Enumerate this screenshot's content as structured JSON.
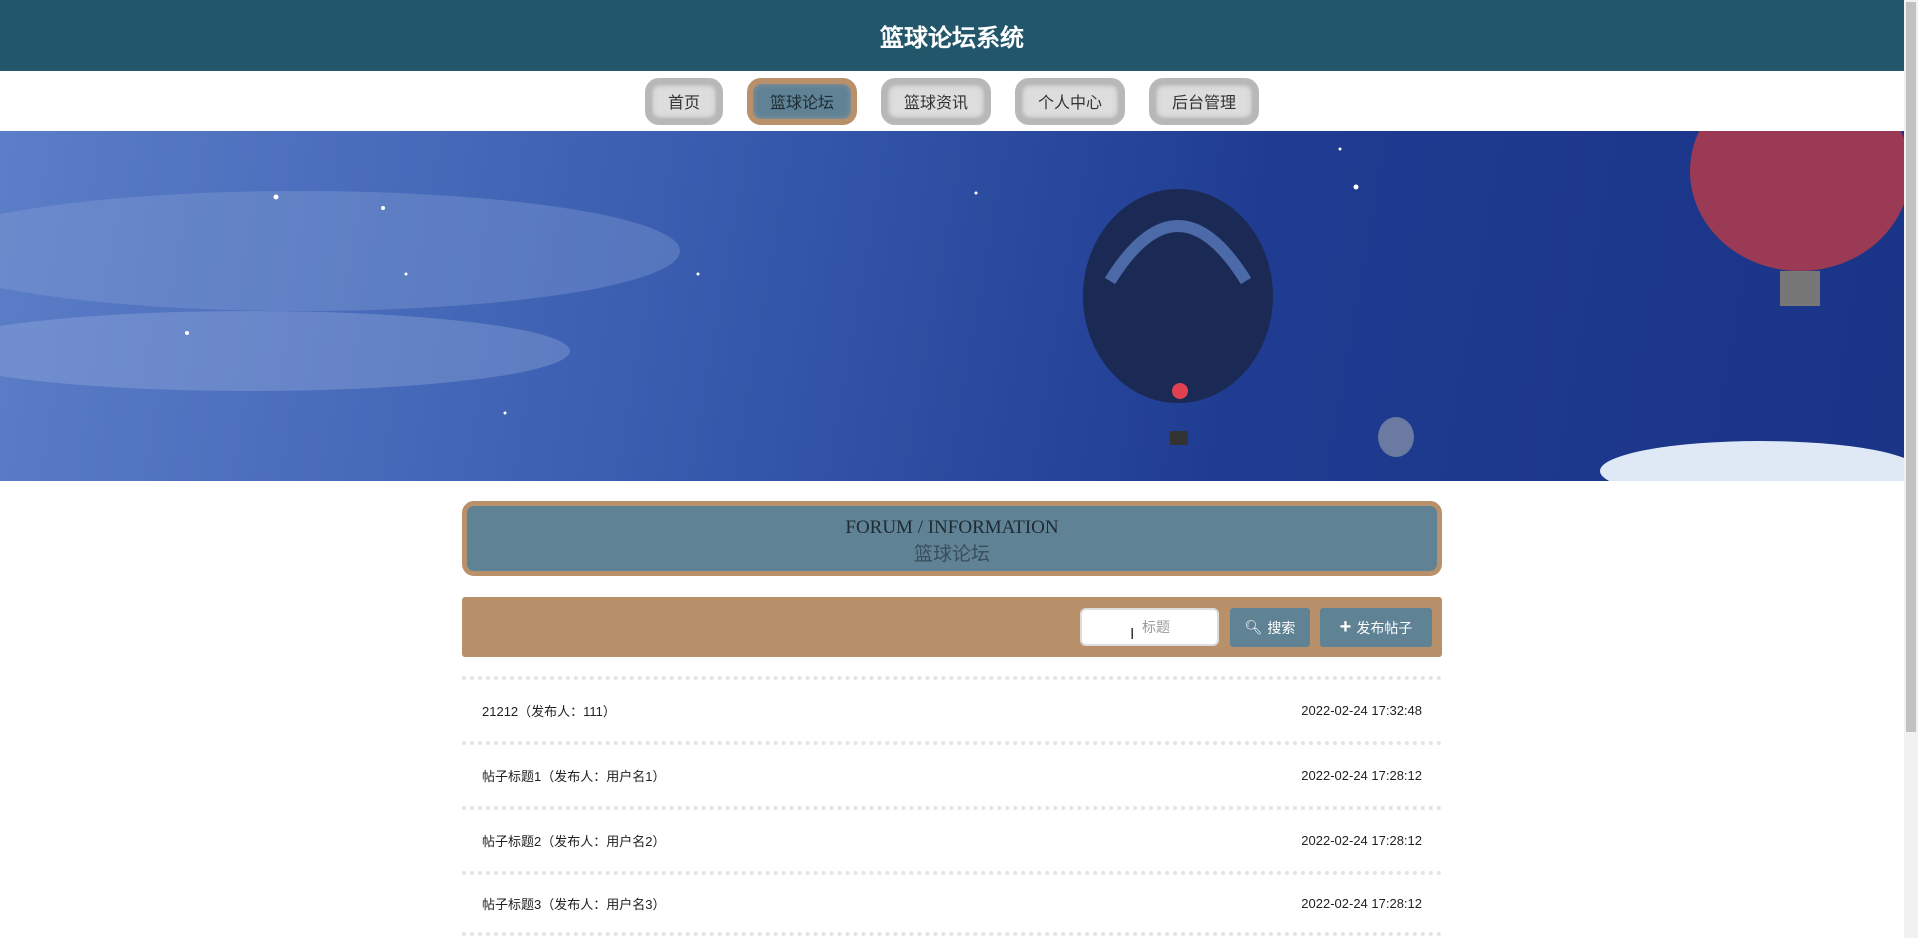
{
  "header": {
    "title": "篮球论坛系统"
  },
  "nav": {
    "items": [
      {
        "label": "首页"
      },
      {
        "label": "篮球论坛",
        "active": true
      },
      {
        "label": "篮球资讯"
      },
      {
        "label": "个人中心"
      },
      {
        "label": "后台管理"
      }
    ]
  },
  "section": {
    "en": "FORUM / INFORMATION",
    "cn": "篮球论坛"
  },
  "toolbar": {
    "search_placeholder": "标题",
    "search_label": "搜索",
    "publish_label": "发布帖子"
  },
  "posts": [
    {
      "title": "21212（发布人：111）",
      "time": "2022-02-24 17:32:48"
    },
    {
      "title": "帖子标题1（发布人：用户名1）",
      "time": "2022-02-24 17:28:12"
    },
    {
      "title": "帖子标题2（发布人：用户名2）",
      "time": "2022-02-24 17:28:12"
    },
    {
      "title": "帖子标题3（发布人：用户名3）",
      "time": "2022-02-24 17:28:12"
    }
  ]
}
